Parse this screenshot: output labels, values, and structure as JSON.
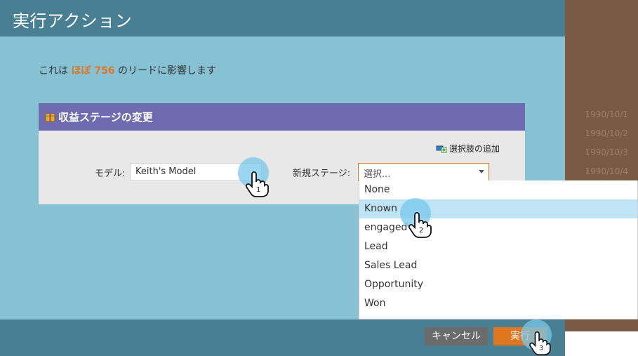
{
  "dialog": {
    "title": "実行アクション",
    "impact_prefix": "これは",
    "impact_highlight": "ほぼ 756",
    "impact_suffix": "のリードに影響します"
  },
  "panel": {
    "title": "収益ステージの変更",
    "add_choice_label": "選択肢の追加",
    "model_label": "モデル:",
    "model_value": "Keith's Model",
    "stage_label": "新規ステージ:",
    "stage_placeholder": "選択..."
  },
  "dropdown": {
    "options": [
      "None",
      "Known",
      "engaged",
      "Lead",
      "Sales Lead",
      "Opportunity",
      "Won"
    ],
    "highlighted": "Known"
  },
  "footer": {
    "cancel_label": "キャンセル",
    "run_label": "実行"
  },
  "background": {
    "dates": [
      "1990/10/1",
      "1990/10/2",
      "1990/10/3",
      "1990/10/4"
    ]
  },
  "callouts": [
    "1",
    "2",
    "3"
  ],
  "colors": {
    "header": "#497f92",
    "dialog_body": "#87c1d4",
    "panel_header": "#6e6bb0",
    "accent_orange": "#e0761f",
    "highlight_row": "#bfe4f5"
  }
}
